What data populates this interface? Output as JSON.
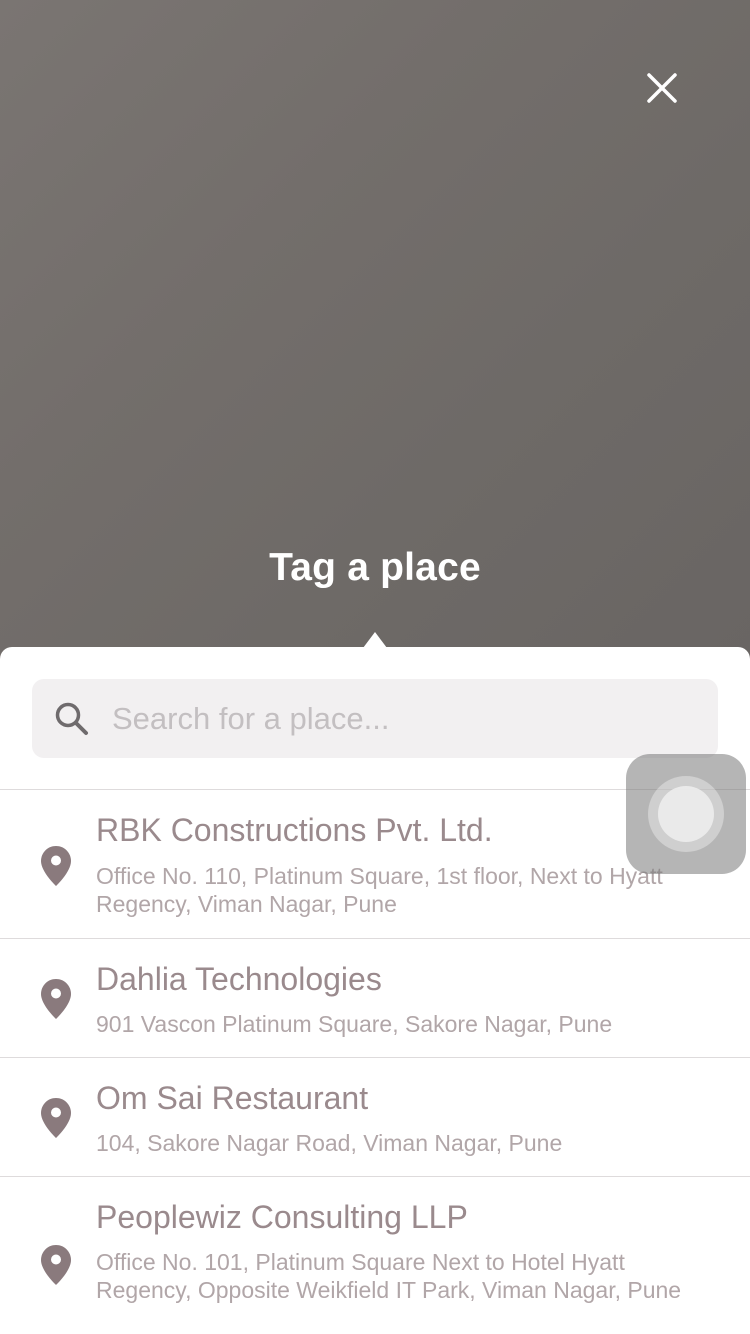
{
  "header": {
    "title": "Tag a place",
    "close_icon": "close-icon"
  },
  "search": {
    "placeholder": "Search for a place...",
    "value": "",
    "icon": "search-icon"
  },
  "places": [
    {
      "name": "RBK Constructions Pvt. Ltd.",
      "address": "Office No. 110, Platinum Square, 1st floor, Next to Hyatt Regency, Viman Nagar, Pune",
      "icon": "map-pin-icon"
    },
    {
      "name": "Dahlia Technologies",
      "address": "901 Vascon Platinum Square, Sakore Nagar, Pune",
      "icon": "map-pin-icon"
    },
    {
      "name": "Om Sai Restaurant",
      "address": "104, Sakore Nagar Road, Viman Nagar, Pune",
      "icon": "map-pin-icon"
    },
    {
      "name": "Peoplewiz Consulting LLP",
      "address": "Office No. 101, Platinum Square Next to Hotel Hyatt Regency, Opposite Weikfield IT Park, Viman Nagar, Pune",
      "icon": "map-pin-icon"
    }
  ],
  "colors": {
    "background_overlay": "#736e6b",
    "title_text": "#ffffff",
    "place_name": "#9a8a8d",
    "place_address": "#b1a6a8",
    "pin": "#8a7a7d",
    "search_bg": "#f2f0f1"
  }
}
